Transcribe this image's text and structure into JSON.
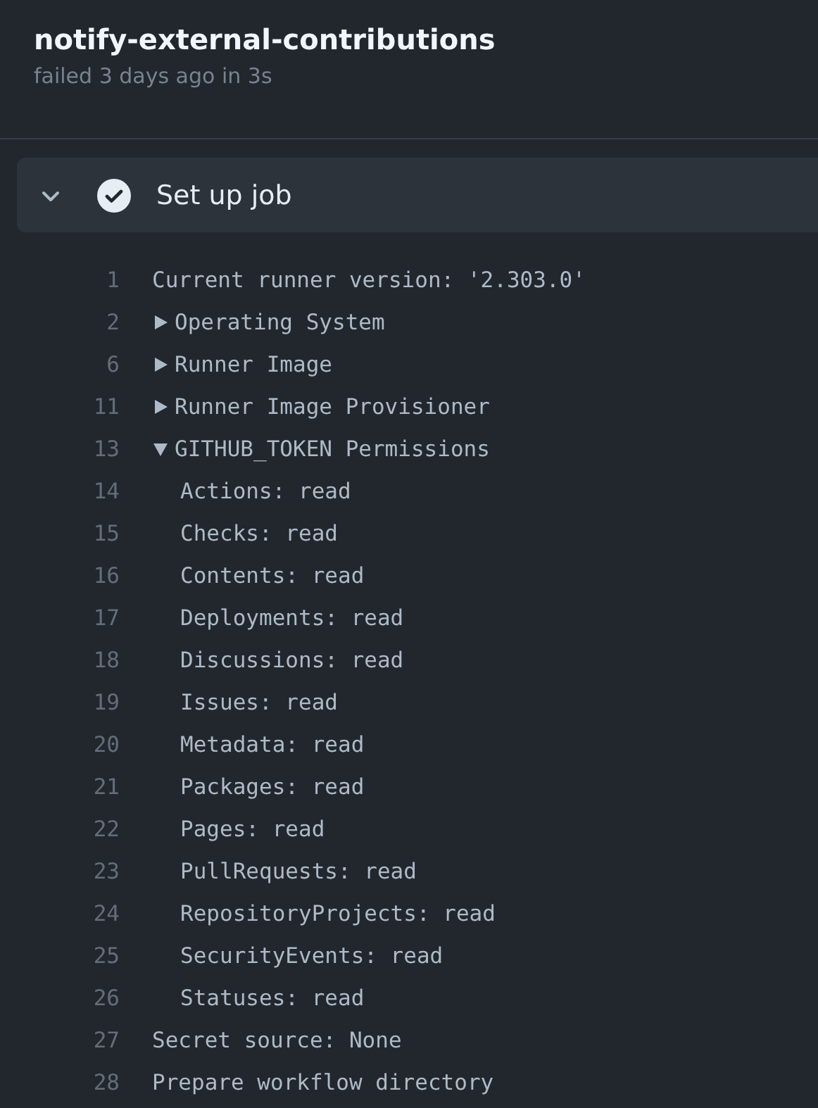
{
  "job": {
    "title": "notify-external-contributions",
    "subtitle": "failed 3 days ago in 3s"
  },
  "step": {
    "title": "Set up job",
    "expanded": true,
    "succeeded": true
  },
  "log": [
    {
      "number": "1",
      "kind": "text",
      "text": "Current runner version: '2.303.0'"
    },
    {
      "number": "2",
      "kind": "group",
      "text": "Operating System",
      "expanded": false
    },
    {
      "number": "6",
      "kind": "group",
      "text": "Runner Image",
      "expanded": false
    },
    {
      "number": "11",
      "kind": "group",
      "text": "Runner Image Provisioner",
      "expanded": false
    },
    {
      "number": "13",
      "kind": "group",
      "text": "GITHUB_TOKEN Permissions",
      "expanded": true,
      "children": [
        {
          "number": "14",
          "kind": "text",
          "text": "Actions: read"
        },
        {
          "number": "15",
          "kind": "text",
          "text": "Checks: read"
        },
        {
          "number": "16",
          "kind": "text",
          "text": "Contents: read"
        },
        {
          "number": "17",
          "kind": "text",
          "text": "Deployments: read"
        },
        {
          "number": "18",
          "kind": "text",
          "text": "Discussions: read"
        },
        {
          "number": "19",
          "kind": "text",
          "text": "Issues: read"
        },
        {
          "number": "20",
          "kind": "text",
          "text": "Metadata: read"
        },
        {
          "number": "21",
          "kind": "text",
          "text": "Packages: read"
        },
        {
          "number": "22",
          "kind": "text",
          "text": "Pages: read"
        },
        {
          "number": "23",
          "kind": "text",
          "text": "PullRequests: read"
        },
        {
          "number": "24",
          "kind": "text",
          "text": "RepositoryProjects: read"
        },
        {
          "number": "25",
          "kind": "text",
          "text": "SecurityEvents: read"
        },
        {
          "number": "26",
          "kind": "text",
          "text": "Statuses: read"
        }
      ]
    },
    {
      "number": "27",
      "kind": "text",
      "text": "Secret source: None"
    },
    {
      "number": "28",
      "kind": "text",
      "text": "Prepare workflow directory"
    }
  ]
}
